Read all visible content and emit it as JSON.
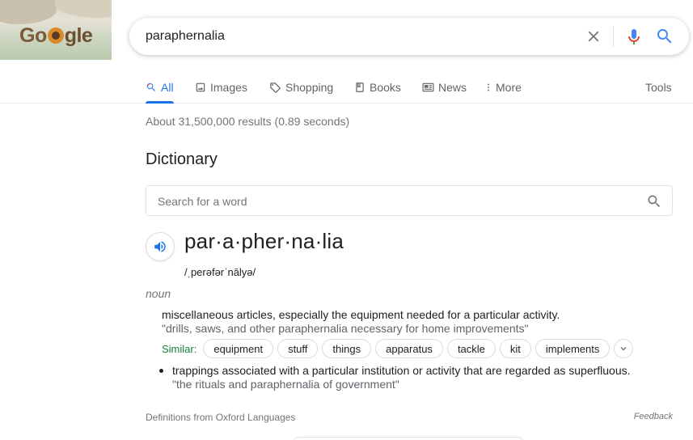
{
  "doodle": {
    "logo_text": "Google"
  },
  "search": {
    "query": "paraphernalia"
  },
  "tabs": [
    {
      "label": "All",
      "icon": "search-icon"
    },
    {
      "label": "Images",
      "icon": "image-icon"
    },
    {
      "label": "Shopping",
      "icon": "tag-icon"
    },
    {
      "label": "Books",
      "icon": "book-icon"
    },
    {
      "label": "News",
      "icon": "newspaper-icon"
    },
    {
      "label": "More",
      "icon": "more-vert-icon"
    },
    {
      "label": "Tools"
    }
  ],
  "results_stats": "About 31,500,000 results (0.89 seconds)",
  "dictionary": {
    "title": "Dictionary",
    "search_placeholder": "Search for a word",
    "word": "par·a·pher·na·lia",
    "phonetic": "/ˌperəfərˈnālyə/",
    "part_of_speech": "noun",
    "definitions": [
      {
        "text": "miscellaneous articles, especially the equipment needed for a particular activity.",
        "example": "\"drills, saws, and other paraphernalia necessary for home improvements\""
      },
      {
        "text": "trappings associated with a particular institution or activity that are regarded as superfluous.",
        "example": "\"the rituals and paraphernalia of government\""
      }
    ],
    "similar_label": "Similar:",
    "similar": [
      "equipment",
      "stuff",
      "things",
      "apparatus",
      "tackle",
      "kit",
      "implements"
    ],
    "source": "Definitions from Oxford Languages",
    "feedback": "Feedback"
  },
  "colors": {
    "accent": "#1a73e8",
    "similar_label": "#188038",
    "muted": "#70757a"
  }
}
